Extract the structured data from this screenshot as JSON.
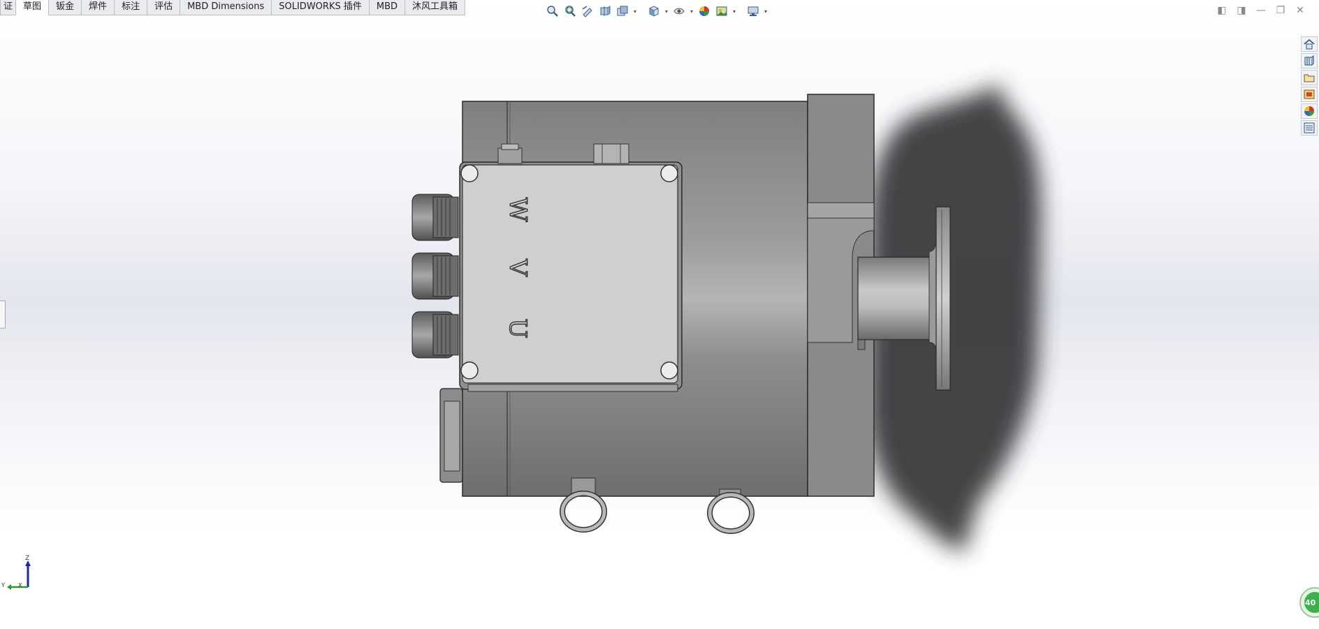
{
  "tabs": [
    {
      "label": "证",
      "active": false
    },
    {
      "label": "草图",
      "active": true
    },
    {
      "label": "钣金",
      "active": false
    },
    {
      "label": "焊件",
      "active": false
    },
    {
      "label": "标注",
      "active": false
    },
    {
      "label": "评估",
      "active": false
    },
    {
      "label": "MBD Dimensions",
      "active": false
    },
    {
      "label": "SOLIDWORKS 插件",
      "active": false
    },
    {
      "label": "MBD",
      "active": false
    },
    {
      "label": "沐风工具箱",
      "active": false
    }
  ],
  "hud_icons": [
    "zoom-to-fit-icon",
    "zoom-to-area-icon",
    "previous-view-icon",
    "section-view-icon",
    "dynamic-annotation-icon",
    "view-orientation-icon",
    "display-style-icon",
    "hide-show-items-icon",
    "edit-appearance-icon",
    "apply-scene-icon",
    "view-settings-icon"
  ],
  "window_controls": [
    "◧",
    "◨",
    "—",
    "❐",
    "✕"
  ],
  "task_pane": [
    "home-icon",
    "design-library-icon",
    "file-explorer-icon",
    "view-palette-icon",
    "appearances-icon",
    "custom-properties-icon"
  ],
  "model": {
    "terminal_labels": [
      "W",
      "V",
      "U"
    ]
  },
  "triad": {
    "z": "Z",
    "y": "Y",
    "x": "X"
  },
  "badge": {
    "label": "40",
    "color": "#3cb04a"
  },
  "colors": {
    "body": "#8c8c8c",
    "box": "#cfcfcf",
    "shadow": "#3a3b3e"
  }
}
